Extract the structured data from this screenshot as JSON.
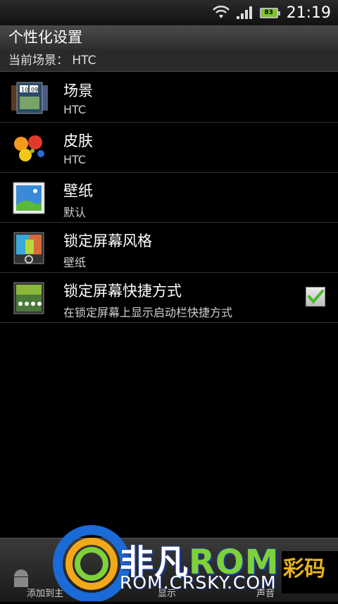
{
  "status_bar": {
    "time": "21:19",
    "battery": "83",
    "icons": [
      "wifi-icon",
      "signal-icon",
      "battery-icon"
    ]
  },
  "title": "个性化设置",
  "subtitle": "当前场景： HTC",
  "items": [
    {
      "title": "场景",
      "subtitle": "HTC",
      "icon": "scene-thumbnail-icon"
    },
    {
      "title": "皮肤",
      "subtitle": "HTC",
      "icon": "skin-paint-icon"
    },
    {
      "title": "壁纸",
      "subtitle": "默认",
      "icon": "wallpaper-icon"
    },
    {
      "title": "锁定屏幕风格",
      "subtitle": "壁纸",
      "icon": "lockscreen-style-icon"
    },
    {
      "title": "锁定屏幕快捷方式",
      "subtitle": "在锁定屏幕上显示启动栏快捷方式",
      "icon": "lockscreen-shortcut-icon",
      "checked": true
    }
  ],
  "bottom_bar": {
    "labels": [
      "添加到主",
      "显示",
      "声音"
    ]
  },
  "watermark": {
    "brand_cn": "非凡",
    "brand_rom": "ROM",
    "url": "ROM.CRSKY.COM",
    "right_text": "彩码"
  },
  "colors": {
    "accent_green": "#7fd13a",
    "watermark_blue": "#1a3a9a"
  }
}
